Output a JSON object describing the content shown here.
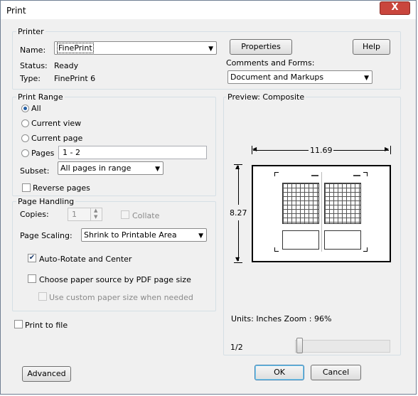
{
  "window": {
    "title": "Print",
    "close_glyph": "X"
  },
  "printer": {
    "group_label": "Printer",
    "name_label": "Name:",
    "name_value": "FinePrint",
    "status_label": "Status:",
    "status_value": "Ready",
    "type_label": "Type:",
    "type_value": "FinePrint 6",
    "properties_button": "Properties",
    "help_button": "Help",
    "comments_label": "Comments and Forms:",
    "comments_value": "Document and Markups"
  },
  "print_range": {
    "group_label": "Print Range",
    "all": "All",
    "current_view": "Current view",
    "current_page": "Current page",
    "pages": "Pages",
    "pages_value": "1 - 2",
    "selected": "all",
    "subset_label": "Subset:",
    "subset_value": "All pages in range",
    "reverse_pages": "Reverse pages",
    "reverse_checked": false
  },
  "page_handling": {
    "group_label": "Page Handling",
    "copies_label": "Copies:",
    "copies_value": "1",
    "collate": "Collate",
    "page_scaling_label": "Page Scaling:",
    "page_scaling_value": "Shrink to Printable Area",
    "auto_rotate": "Auto-Rotate and Center",
    "auto_rotate_checked": true,
    "choose_paper": "Choose paper source by PDF page size",
    "choose_paper_checked": false,
    "custom_paper": "Use custom paper size when needed",
    "custom_paper_checked": false
  },
  "print_to_file": {
    "label": "Print to file",
    "checked": false
  },
  "preview": {
    "label": "Preview: Composite",
    "width_dim": "11.69",
    "height_dim": "8.27",
    "units_zoom": "Units: Inches Zoom :  96%",
    "page_counter": "1/2",
    "slider_fraction": 0.0
  },
  "buttons": {
    "advanced": "Advanced",
    "ok": "OK",
    "cancel": "Cancel"
  }
}
